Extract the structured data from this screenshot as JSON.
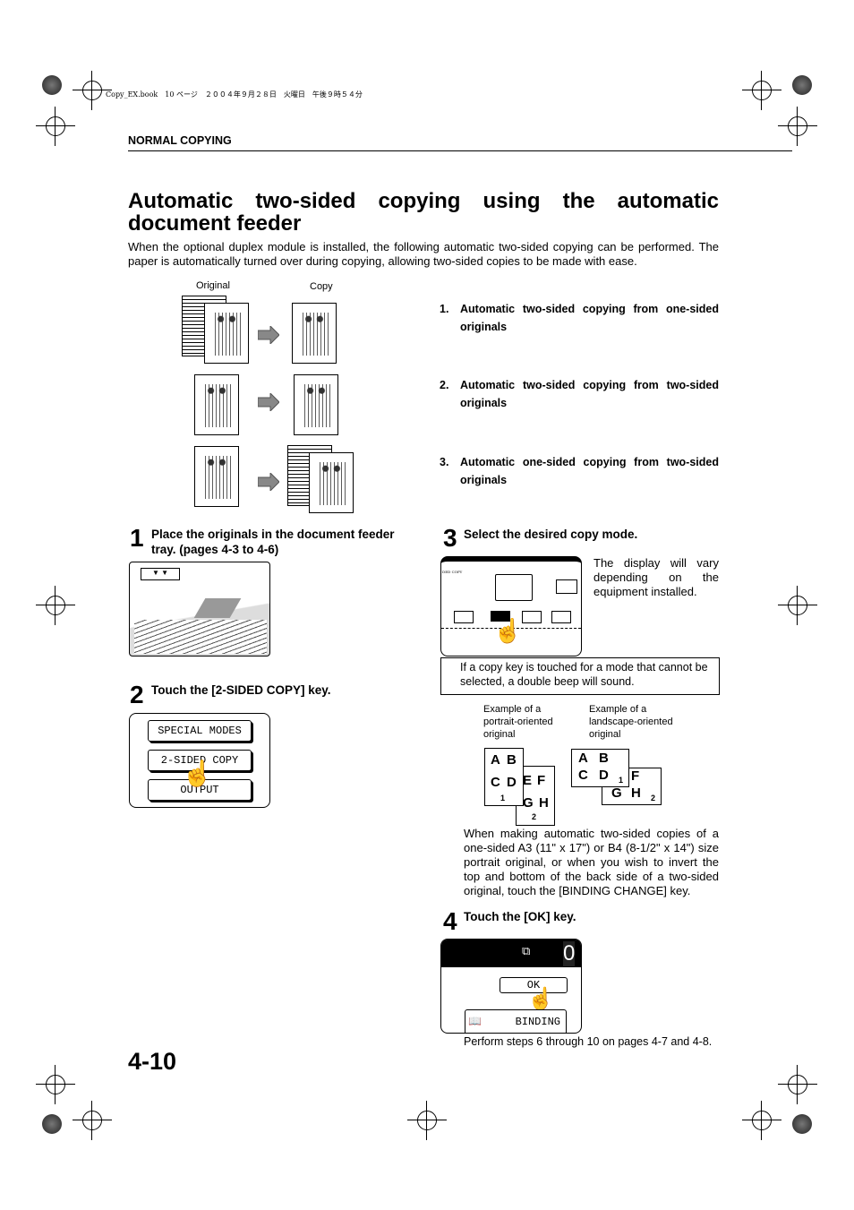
{
  "print_header": "Copy_EX.book　10 ページ　２００４年９月２８日　火曜日　午後９時５４分",
  "section": "NORMAL COPYING",
  "title": "Automatic two-sided copying using the automatic document feeder",
  "intro": "When the optional duplex module is installed, the following automatic two-sided copying can be performed. The paper is automatically turned over during copying, allowing two-sided copies to be made with ease.",
  "diagram": {
    "original_label": "Original",
    "copy_label": "Copy"
  },
  "modes": [
    {
      "num": "1.",
      "text": "Automatic two-sided copying from one-sided originals"
    },
    {
      "num": "2.",
      "text": "Automatic two-sided copying from two-sided originals"
    },
    {
      "num": "3.",
      "text": "Automatic one-sided copying from two-sided originals"
    }
  ],
  "steps": [
    {
      "num": "1",
      "text": "Place the originals in the document feeder tray. (pages 4-3 to 4-6)"
    },
    {
      "num": "2",
      "text": "Touch the [2-SIDED COPY] key.",
      "keys": [
        "SPECIAL MODES",
        "2-SIDED COPY",
        "OUTPUT"
      ]
    },
    {
      "num": "3",
      "text": "Select the desired copy mode.",
      "screen_title": "DED COPY",
      "note": "The display will vary depending on the equipment installed.",
      "warning": "If a copy key is touched for a mode that cannot be selected, a double beep will sound.",
      "portrait_label": "Example of a portrait-oriented original",
      "landscape_label": "Example of a landscape-oriented original",
      "explain": "When making automatic two-sided copies of a one-sided A3 (11\" x 17\") or B4 (8-1/2\" x 14\") size portrait original, or when you wish to invert the top and bottom of the back side of a two-sided original, touch the [BINDING CHANGE] key."
    },
    {
      "num": "4",
      "text": "Touch the [OK] key.",
      "ok": "OK",
      "binding": "BINDING",
      "counter": "0",
      "footer": "Perform steps 6 through 10 on pages 4-7 and 4-8."
    }
  ],
  "letters": {
    "front": [
      "A",
      "B",
      "C",
      "D"
    ],
    "back": [
      "E",
      "F",
      "G",
      "H"
    ],
    "p1": "1",
    "p2": "2"
  },
  "page_number": "4-10"
}
